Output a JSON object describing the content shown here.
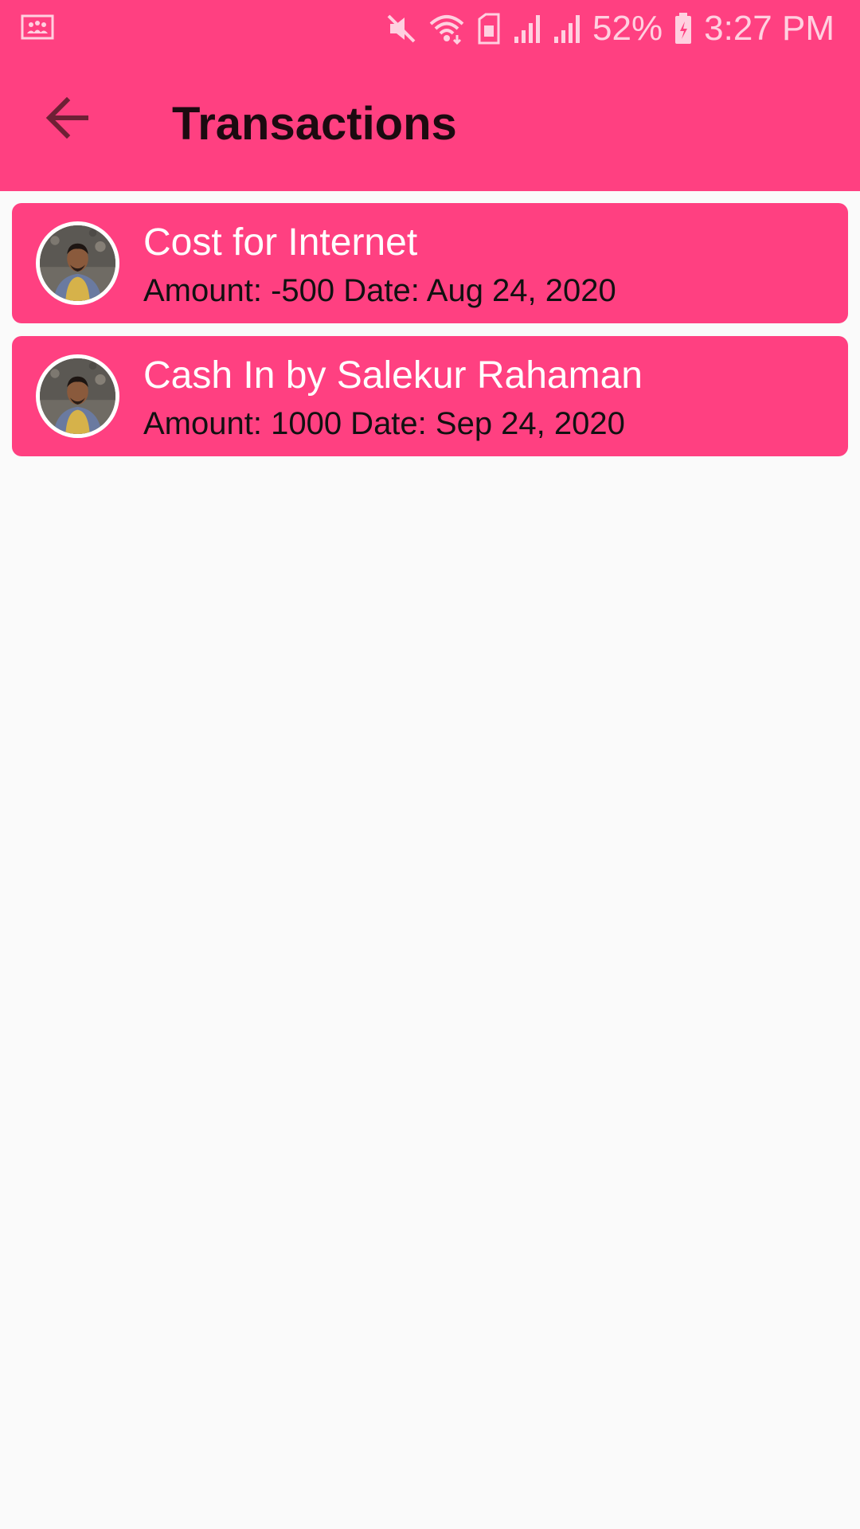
{
  "status_bar": {
    "battery_percent": "52%",
    "time": "3:27 PM",
    "icons": [
      "gallery-notification-icon",
      "mute-icon",
      "wifi-icon",
      "sim-icon",
      "signal-1-icon",
      "signal-2-icon",
      "battery-charging-icon"
    ]
  },
  "app_bar": {
    "title": "Transactions",
    "back_icon": "arrow-back-icon"
  },
  "transactions": [
    {
      "title": "Cost for Internet",
      "subtitle": "Amount: -500 Date: Aug 24, 2020"
    },
    {
      "title": "Cash In by Salekur Rahaman",
      "subtitle": "Amount: 1000 Date: Sep 24, 2020"
    }
  ],
  "colors": {
    "primary": "#ff4081",
    "background": "#fafafa",
    "title_text": "#1c0a10",
    "card_title_text": "#ffffff",
    "card_subtitle_text": "#111111"
  }
}
